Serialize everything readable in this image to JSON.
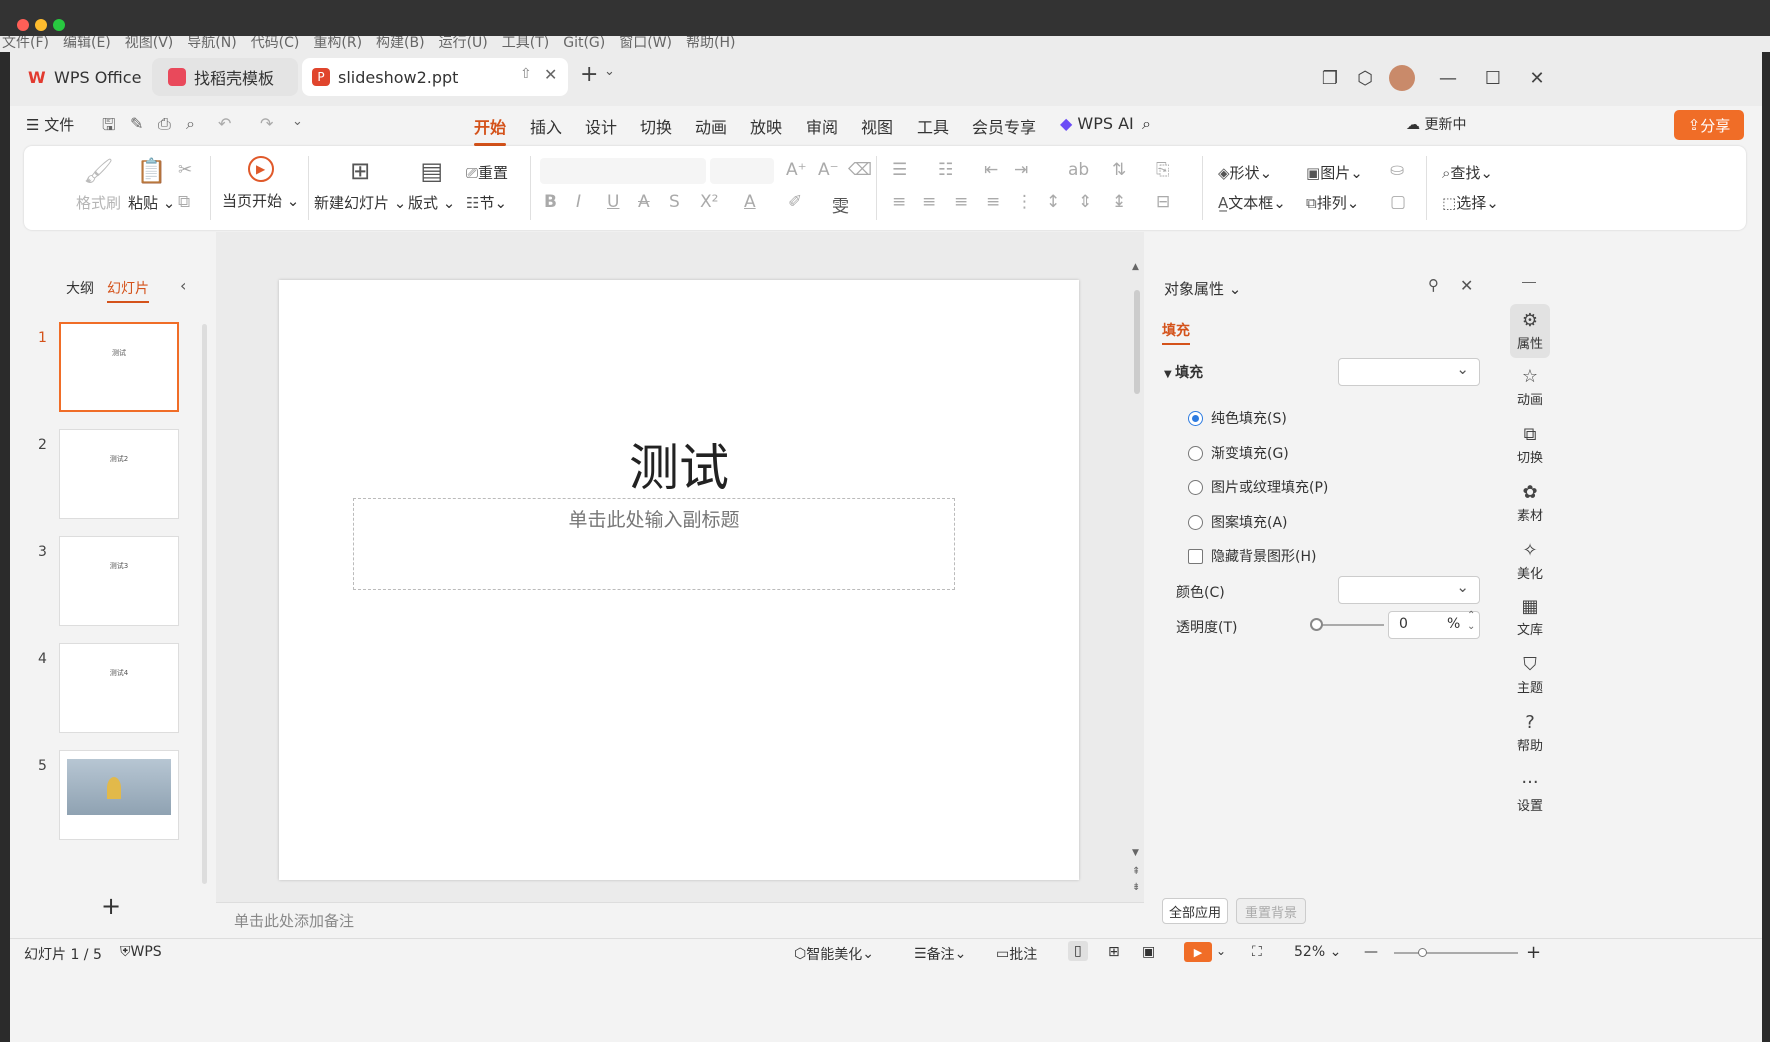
{
  "ghost_menu": [
    "文件(F)",
    "编辑(E)",
    "视图(V)",
    "导航(N)",
    "代码(C)",
    "重构(R)",
    "构建(B)",
    "运行(U)",
    "工具(T)",
    "Git(G)",
    "窗口(W)",
    "帮助(H)"
  ],
  "tabs": {
    "wps": "WPS Office",
    "template": "找稻壳模板",
    "doc": "slideshow2.ppt"
  },
  "menu": {
    "file": "文件",
    "items": [
      "开始",
      "插入",
      "设计",
      "切换",
      "动画",
      "放映",
      "审阅",
      "视图",
      "工具",
      "会员专享"
    ],
    "wps_ai": "WPS AI",
    "updating": "更新中",
    "share": "分享"
  },
  "ribbon": {
    "format_painter": "格式刷",
    "paste": "粘贴",
    "from_current": "当页开始",
    "new_slide": "新建幻灯片",
    "layout": "版式",
    "reset": "重置",
    "section": "节",
    "shape": "形状",
    "picture": "图片",
    "textbox": "文本框",
    "arrange": "排列",
    "find": "查找",
    "select": "选择"
  },
  "left": {
    "outline": "大纲",
    "slides": "幻灯片",
    "thumbs": [
      {
        "num": "1",
        "text": "测试"
      },
      {
        "num": "2",
        "text": "测试2"
      },
      {
        "num": "3",
        "text": "测试3"
      },
      {
        "num": "4",
        "text": "测试4"
      },
      {
        "num": "5",
        "text": ""
      }
    ]
  },
  "slide": {
    "title": "测试",
    "subtitle_placeholder": "单击此处输入副标题"
  },
  "notes_placeholder": "单击此处添加备注",
  "props": {
    "title": "对象属性",
    "tab_fill": "填充",
    "section_fill": "填充",
    "options": [
      "纯色填充(S)",
      "渐变填充(G)",
      "图片或纹理填充(P)",
      "图案填充(A)"
    ],
    "hide_bg": "隐藏背景图形(H)",
    "color": "颜色(C)",
    "transparency": "透明度(T)",
    "transparency_value": "0",
    "percent": "%",
    "apply_all": "全部应用",
    "reset_bg": "重置背景"
  },
  "side_tools": [
    "属性",
    "动画",
    "切换",
    "素材",
    "美化",
    "文库",
    "主题",
    "帮助",
    "设置"
  ],
  "status": {
    "slide_count": "幻灯片 1 / 5",
    "wps": "WPS",
    "beautify": "智能美化",
    "notes": "备注",
    "comments": "批注",
    "zoom": "52%"
  }
}
